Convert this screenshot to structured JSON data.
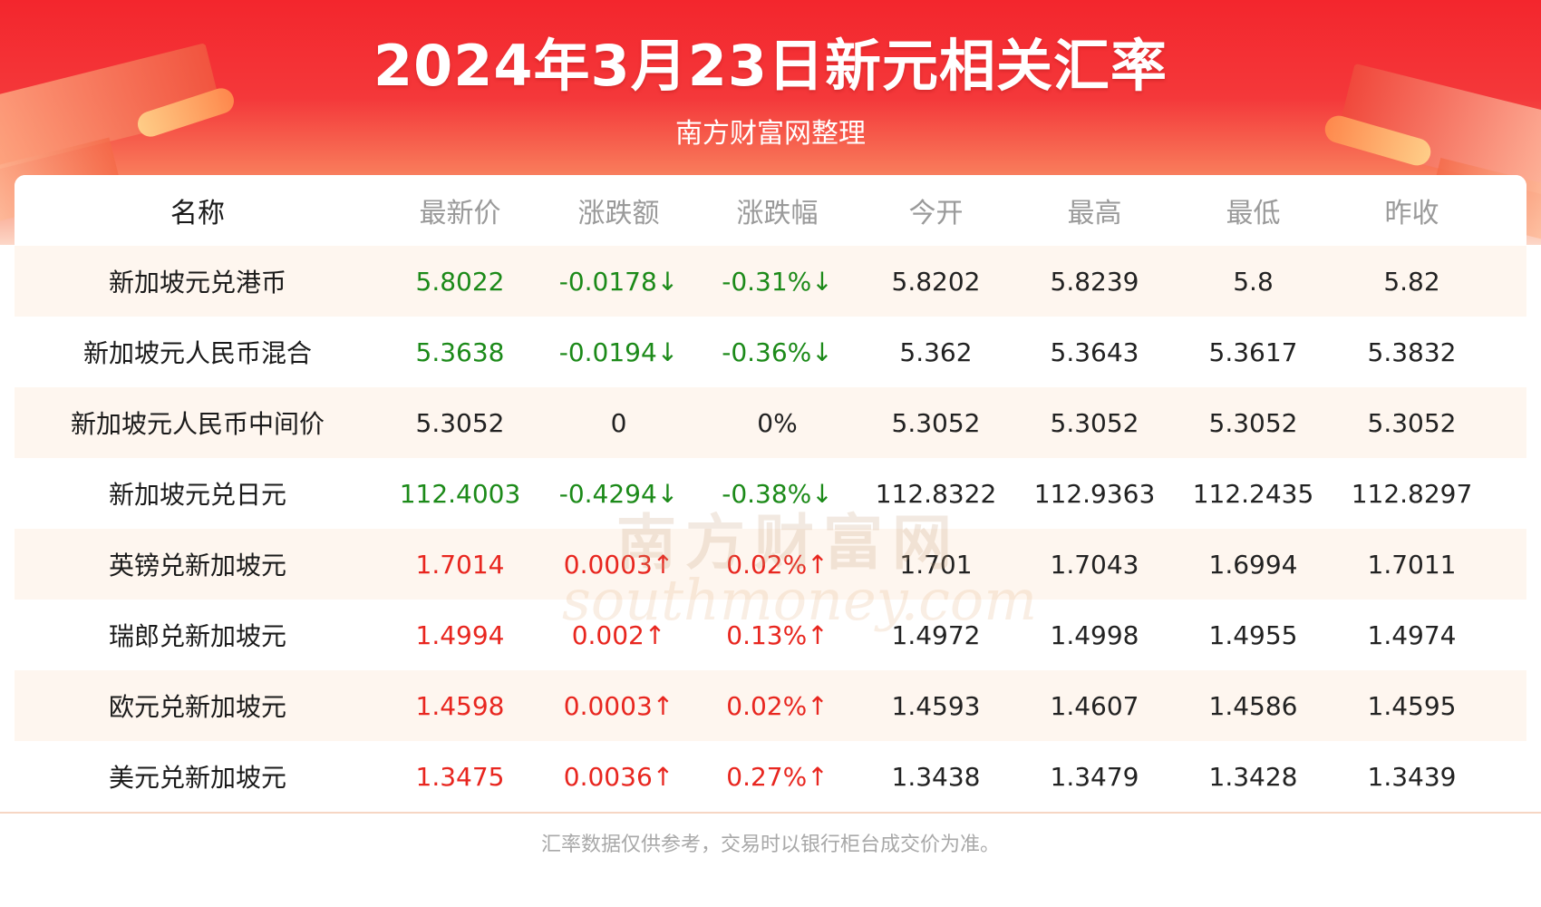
{
  "header": {
    "title": "2024年3月23日新元相关汇率",
    "subtitle": "南方财富网整理"
  },
  "table": {
    "columns": [
      "名称",
      "最新价",
      "涨跌额",
      "涨跌幅",
      "今开",
      "最高",
      "最低",
      "昨收"
    ],
    "rows": [
      {
        "name": "新加坡元兑港币",
        "latest": "5.8022",
        "change": "-0.0178↓",
        "pct": "-0.31%↓",
        "open": "5.8202",
        "high": "5.8239",
        "low": "5.8",
        "prev": "5.82",
        "trend": "down"
      },
      {
        "name": "新加坡元人民币混合",
        "latest": "5.3638",
        "change": "-0.0194↓",
        "pct": "-0.36%↓",
        "open": "5.362",
        "high": "5.3643",
        "low": "5.3617",
        "prev": "5.3832",
        "trend": "down"
      },
      {
        "name": "新加坡元人民币中间价",
        "latest": "5.3052",
        "change": "0",
        "pct": "0%",
        "open": "5.3052",
        "high": "5.3052",
        "low": "5.3052",
        "prev": "5.3052",
        "trend": "flat"
      },
      {
        "name": "新加坡元兑日元",
        "latest": "112.4003",
        "change": "-0.4294↓",
        "pct": "-0.38%↓",
        "open": "112.8322",
        "high": "112.9363",
        "low": "112.2435",
        "prev": "112.8297",
        "trend": "down"
      },
      {
        "name": "英镑兑新加坡元",
        "latest": "1.7014",
        "change": "0.0003↑",
        "pct": "0.02%↑",
        "open": "1.701",
        "high": "1.7043",
        "low": "1.6994",
        "prev": "1.7011",
        "trend": "up"
      },
      {
        "name": "瑞郎兑新加坡元",
        "latest": "1.4994",
        "change": "0.002↑",
        "pct": "0.13%↑",
        "open": "1.4972",
        "high": "1.4998",
        "low": "1.4955",
        "prev": "1.4974",
        "trend": "up"
      },
      {
        "name": "欧元兑新加坡元",
        "latest": "1.4598",
        "change": "0.0003↑",
        "pct": "0.02%↑",
        "open": "1.4593",
        "high": "1.4607",
        "low": "1.4586",
        "prev": "1.4595",
        "trend": "up"
      },
      {
        "name": "美元兑新加坡元",
        "latest": "1.3475",
        "change": "0.0036↑",
        "pct": "0.27%↑",
        "open": "1.3438",
        "high": "1.3479",
        "low": "1.3428",
        "prev": "1.3439",
        "trend": "up"
      }
    ]
  },
  "watermark": {
    "cn": "南方财富网",
    "en": "southmoney.com"
  },
  "footer": {
    "note": "汇率数据仅供参考，交易时以银行柜台成交价为准。"
  },
  "colors": {
    "header_red": "#f3262d",
    "up": "#e8261f",
    "down": "#1c8a19",
    "row_tint": "#fef6ef"
  }
}
